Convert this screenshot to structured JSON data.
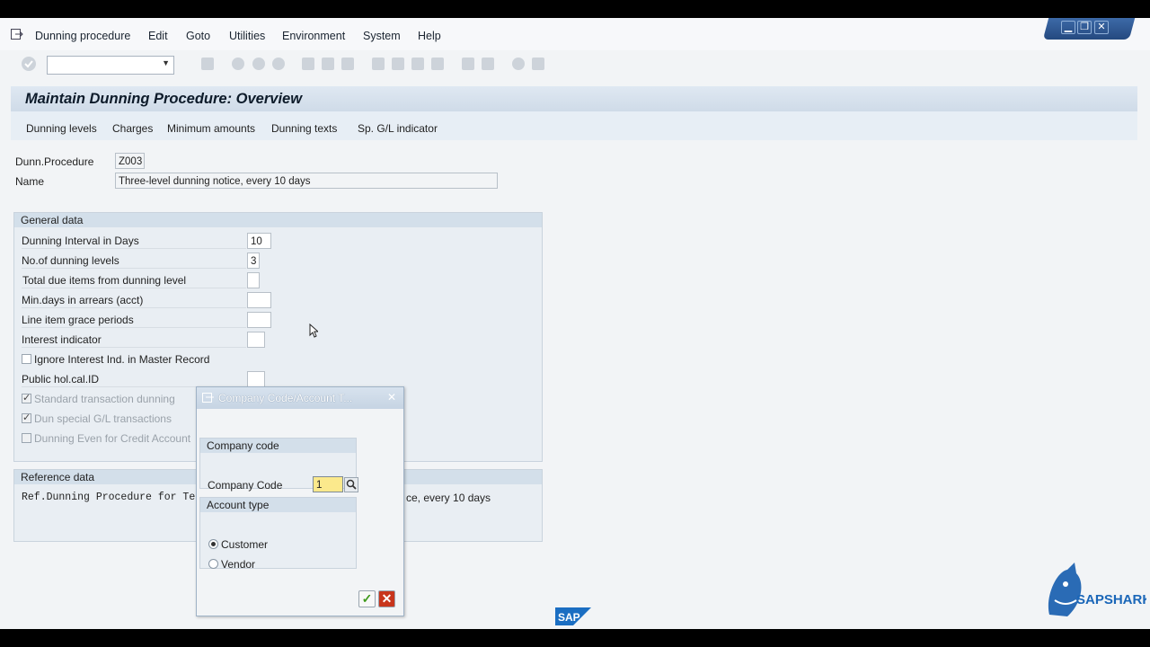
{
  "menu": [
    "Dunning procedure",
    "Edit",
    "Goto",
    "Utilities",
    "Environment",
    "System",
    "Help"
  ],
  "window_controls": {
    "minimize": "▁",
    "restore": "❐",
    "close": "✕"
  },
  "title": "Maintain Dunning Procedure: Overview",
  "app_toolbar": [
    "Dunning levels",
    "Charges",
    "Minimum amounts",
    "Dunning texts",
    "Sp. G/L indicator"
  ],
  "header_fields": {
    "procedure_label": "Dunn.Procedure",
    "procedure_value": "Z003",
    "name_label": "Name",
    "name_value": "Three-level dunning notice, every 10 days"
  },
  "general": {
    "title": "General data",
    "interval_label": "Dunning Interval in Days",
    "interval_value": "10",
    "levels_label": "No.of dunning levels",
    "levels_value": "3",
    "total_due_label": "Total due items from dunning level",
    "min_days_label": "Min.days in arrears (acct)",
    "grace_label": "Line item grace periods",
    "interest_label": "Interest indicator",
    "ignore_interest_label": "Ignore Interest Ind. in Master Record",
    "ignore_interest_checked": false,
    "public_hol_label": "Public hol.cal.ID",
    "std_txn_label": "Standard transaction dunning",
    "std_txn_checked": true,
    "special_gl_label": "Dun special G/L transactions",
    "special_gl_checked": true,
    "credit_label": "Dunning Even for Credit Account",
    "credit_checked": false
  },
  "reference": {
    "title": "Reference data",
    "ref_label": "Ref.Dunning Procedure for Te",
    "ref_value_tail": "ce, every 10 days"
  },
  "dialog": {
    "title": "Company Code/Account T...",
    "company_group": "Company code",
    "company_label": "Company Code",
    "company_value": "1",
    "account_group": "Account type",
    "customer_label": "Customer",
    "vendor_label": "Vendor",
    "selected": "Customer"
  },
  "logos": {
    "sap": "SAP",
    "sapsharks": "SAPSHARKS"
  },
  "colors": {
    "accent": "#24497f",
    "input_highlight": "#fbe98c",
    "ok_green": "#3f9a1c",
    "cancel_red": "#c8351c"
  }
}
